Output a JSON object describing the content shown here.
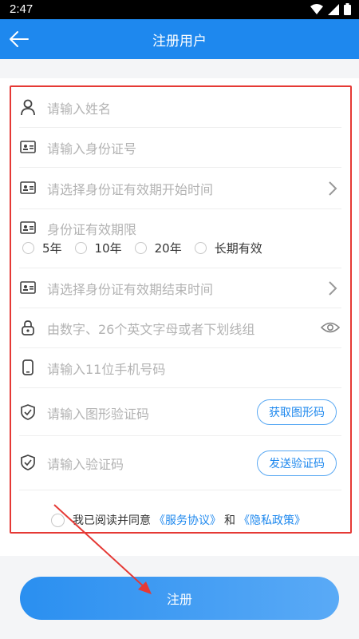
{
  "status_bar": {
    "time": "2:47"
  },
  "app_bar": {
    "title": "注册用户"
  },
  "form": {
    "name_placeholder": "请输入姓名",
    "id_number_placeholder": "请输入身份证号",
    "id_start_placeholder": "请选择身份证有效期开始时间",
    "id_validity_label": "身份证有效期限",
    "validity_options": [
      "5年",
      "10年",
      "20年",
      "长期有效"
    ],
    "id_end_placeholder": "请选择身份证有效期结束时间",
    "password_placeholder": "由数字、26个英文字母或者下划线组",
    "phone_placeholder": "请输入11位手机号码",
    "captcha_placeholder": "请输入图形验证码",
    "captcha_button": "获取图形码",
    "sms_placeholder": "请输入验证码",
    "sms_button": "发送验证码"
  },
  "agreement": {
    "prefix": "我已阅读并同意",
    "service_link": "《服务协议》",
    "and": "和",
    "privacy_link": "《隐私政策》"
  },
  "register_button": "注册",
  "colors": {
    "primary": "#1e88ee",
    "annotation": "#e53935",
    "placeholder": "#b3b3b3"
  }
}
